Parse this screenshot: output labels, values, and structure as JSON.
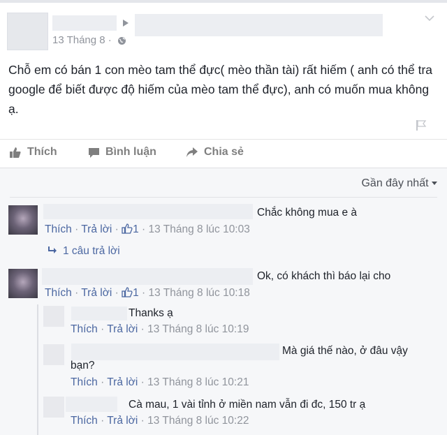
{
  "post": {
    "date": "13 Tháng 8 ·",
    "body": "Chỗ em có bán 1 con mèo tam thể đực( mèo thần tài) rất hiếm ( anh có thể tra google để biết được độ hiếm của mèo tam thể đực), anh có muốn mua không ạ."
  },
  "actions": {
    "like": "Thích",
    "comment": "Bình luận",
    "share": "Chia sẻ"
  },
  "sort_label": "Gần đây nhất",
  "comments": [
    {
      "text": "Chắc không mua e à",
      "like": "Thích",
      "reply": "Trả lời",
      "likes": "1",
      "time": "13 Tháng 8 lúc 10:03",
      "replies_label": "1 câu trả lời"
    },
    {
      "text": "Ok, có khách thì báo lại cho",
      "like": "Thích",
      "reply": "Trả lời",
      "likes": "1",
      "time": "13 Tháng 8 lúc 10:18"
    }
  ],
  "replies": [
    {
      "text": "Thanks ạ",
      "like": "Thích",
      "reply": "Trả lời",
      "time": "13 Tháng 8 lúc 10:19"
    },
    {
      "text": "Mà giá thế nào, ở đâu vậy",
      "text2": "bạn?",
      "like": "Thích",
      "reply": "Trả lời",
      "time": "13 Tháng 8 lúc 10:21"
    },
    {
      "text": "Cà mau, 1 vài tỉnh ở miền nam vẫn đi đc, 150 tr ạ",
      "like": "Thích",
      "reply": "Trả lời",
      "time": "13 Tháng 8 lúc 10:22"
    }
  ]
}
